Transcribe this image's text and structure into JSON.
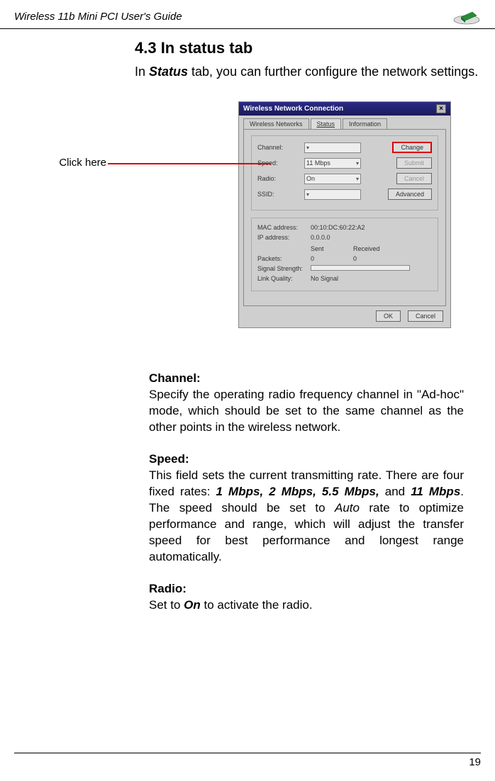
{
  "header": {
    "title": "Wireless 11b Mini PCI  User's Guide"
  },
  "section": {
    "title": "4.3 In status tab",
    "intro_pre": "In ",
    "intro_bold": "Status",
    "intro_post": " tab, you can further configure the network settings."
  },
  "callout": "Click here",
  "dialog": {
    "title": "Wireless Network Connection",
    "tabs": {
      "t1": "Wireless Networks",
      "t2": "Status",
      "t3": "Information"
    },
    "group1": {
      "channel_label": "Channel:",
      "channel_btn": "Change",
      "speed_label": "Speed:",
      "speed_value": "11 Mbps",
      "speed_btn": "Submit",
      "radio_label": "Radio:",
      "radio_value": "On",
      "radio_btn": "Cancel",
      "ssid_label": "SSID:",
      "ssid_btn": "Advanced"
    },
    "group2": {
      "mac_label": "MAC address:",
      "mac_value": "00:10:DC:60:22:A2",
      "ip_label": "IP address:",
      "ip_value": "0.0.0.0",
      "sent": "Sent",
      "recv": "Received",
      "packets_label": "Packets:",
      "packets_sent": "0",
      "packets_recv": "0",
      "sig_label": "Signal Strength:",
      "link_label": "Link Quality:",
      "link_value": "No Signal"
    },
    "buttons": {
      "ok": "OK",
      "cancel": "Cancel"
    }
  },
  "body": {
    "channel_h": "Channel:",
    "channel_p": "Specify the operating radio frequency channel in \"Ad-hoc\" mode, which should be set to the same channel as the other points in the wireless network.",
    "speed_h": "Speed:",
    "speed_pre": "This field sets the current transmitting rate. There are four fixed rates: ",
    "speed_rates": "1 Mbps, 2 Mbps, 5.5 Mbps,",
    "speed_and": " and ",
    "speed_last": "11 Mbps",
    "speed_mid": ". The speed should be set to ",
    "speed_auto": "Auto",
    "speed_post": " rate to optimize performance and range, which will adjust the transfer speed for best performance and longest range automatically.",
    "radio_h": "Radio:",
    "radio_pre": "Set to ",
    "radio_on": "On",
    "radio_post": " to activate the radio."
  },
  "footer": {
    "page": "19"
  }
}
